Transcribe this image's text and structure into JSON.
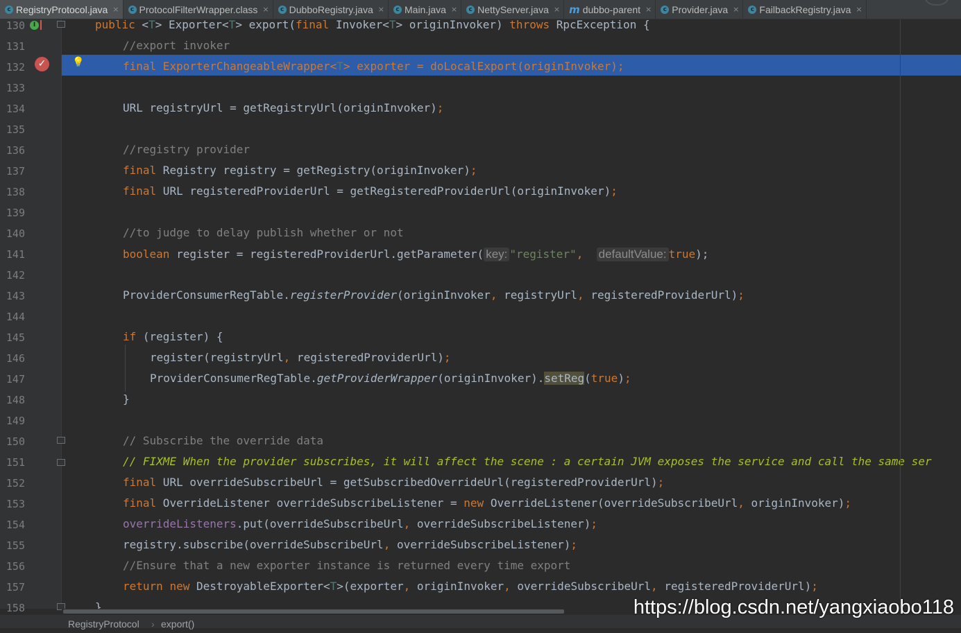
{
  "tabs": [
    {
      "label": "RegistryProtocol.java",
      "icon": "c",
      "active": true
    },
    {
      "label": "ProtocolFilterWrapper.class",
      "icon": "c",
      "active": false
    },
    {
      "label": "DubboRegistry.java",
      "icon": "c",
      "active": false
    },
    {
      "label": "Main.java",
      "icon": "c",
      "active": false
    },
    {
      "label": "NettyServer.java",
      "icon": "c",
      "active": false
    },
    {
      "label": "dubbo-parent",
      "icon": "m",
      "active": false
    },
    {
      "label": "Provider.java",
      "icon": "c",
      "active": false
    },
    {
      "label": "FailbackRegistry.java",
      "icon": "c",
      "active": false
    }
  ],
  "tab_close": "×",
  "line_numbers": [
    "130",
    "131",
    "132",
    "133",
    "134",
    "135",
    "136",
    "137",
    "138",
    "139",
    "140",
    "141",
    "142",
    "143",
    "144",
    "145",
    "146",
    "147",
    "148",
    "149",
    "150",
    "151",
    "152",
    "153",
    "154",
    "155",
    "156",
    "157",
    "158"
  ],
  "code": {
    "l130": [
      "public",
      " <",
      "T",
      "> Exporter<",
      "T",
      "> export(",
      "final",
      " Invoker<",
      "T",
      "> originInvoker) ",
      "throws",
      " RpcException {"
    ],
    "l131": "//export invoker",
    "l132": [
      "final",
      " ExporterChangeableWrapper<",
      "T",
      "> exporter = doLocalExport(originInvoker)",
      ";"
    ],
    "l134": [
      "URL registryUrl = getRegistryUrl(originInvoker)",
      ";"
    ],
    "l136": "//registry provider",
    "l137": [
      "final",
      " Registry registry = getRegistry(originInvoker)",
      ";"
    ],
    "l138": [
      "final",
      " URL registeredProviderUrl = getRegisteredProviderUrl(originInvoker)",
      ";"
    ],
    "l140": "//to judge to delay publish whether or not",
    "l141": [
      "boolean",
      " register = registeredProviderUrl.getParameter(",
      "key:",
      "\"register\"",
      ",",
      "defaultValue:",
      "true",
      ");"
    ],
    "l143": [
      "ProviderConsumerRegTable.",
      "registerProvider",
      "(originInvoker",
      ",",
      " registryUrl",
      ",",
      " registeredProviderUrl)",
      ";"
    ],
    "l145": [
      "if",
      " (register) {"
    ],
    "l146": [
      "register(registryUrl",
      ",",
      " registeredProviderUrl)",
      ";"
    ],
    "l147": [
      "ProviderConsumerRegTable.",
      "getProviderWrapper",
      "(originInvoker).",
      "setReg",
      "(",
      "true",
      ")",
      ";"
    ],
    "l148": "}",
    "l150": "// Subscribe the override data",
    "l151": [
      "// ",
      "FIXME When the provider subscribes, it will affect the scene : a certain JVM exposes the service and call the same ser"
    ],
    "l152": [
      "final",
      " URL overrideSubscribeUrl = getSubscribedOverrideUrl(registeredProviderUrl)",
      ";"
    ],
    "l153": [
      "final",
      " OverrideListener overrideSubscribeListener = ",
      "new",
      " OverrideListener(overrideSubscribeUrl",
      ",",
      " originInvoker)",
      ";"
    ],
    "l154": [
      "overrideListeners",
      ".put(overrideSubscribeUrl",
      ",",
      " overrideSubscribeListener)",
      ";"
    ],
    "l155": [
      "registry.subscribe(overrideSubscribeUrl",
      ",",
      " overrideSubscribeListener)",
      ";"
    ],
    "l156": "//Ensure that a new exporter instance is returned every time export",
    "l157": [
      "return",
      " ",
      "new",
      " DestroyableExporter<",
      "T",
      ">(exporter",
      ",",
      " originInvoker",
      ",",
      " overrideSubscribeUrl",
      ",",
      " registeredProviderUrl)",
      ";"
    ],
    "l158": "}"
  },
  "gutter_icons": {
    "implements": "I",
    "breakpoint": "✓",
    "bulb": "💡"
  },
  "breadcrumb": {
    "class_name": "RegistryProtocol",
    "separator": "›",
    "method": "export()"
  },
  "watermark": "https://blog.csdn.net/yangxiaobo118",
  "colors": {
    "background": "#2B2B2B",
    "keyword": "#CC7832",
    "comment": "#808080",
    "string": "#6A8759",
    "todo": "#A8C023",
    "field": "#9876AA",
    "selection": "#2D5DA8",
    "breakpoint": "#C75450"
  }
}
